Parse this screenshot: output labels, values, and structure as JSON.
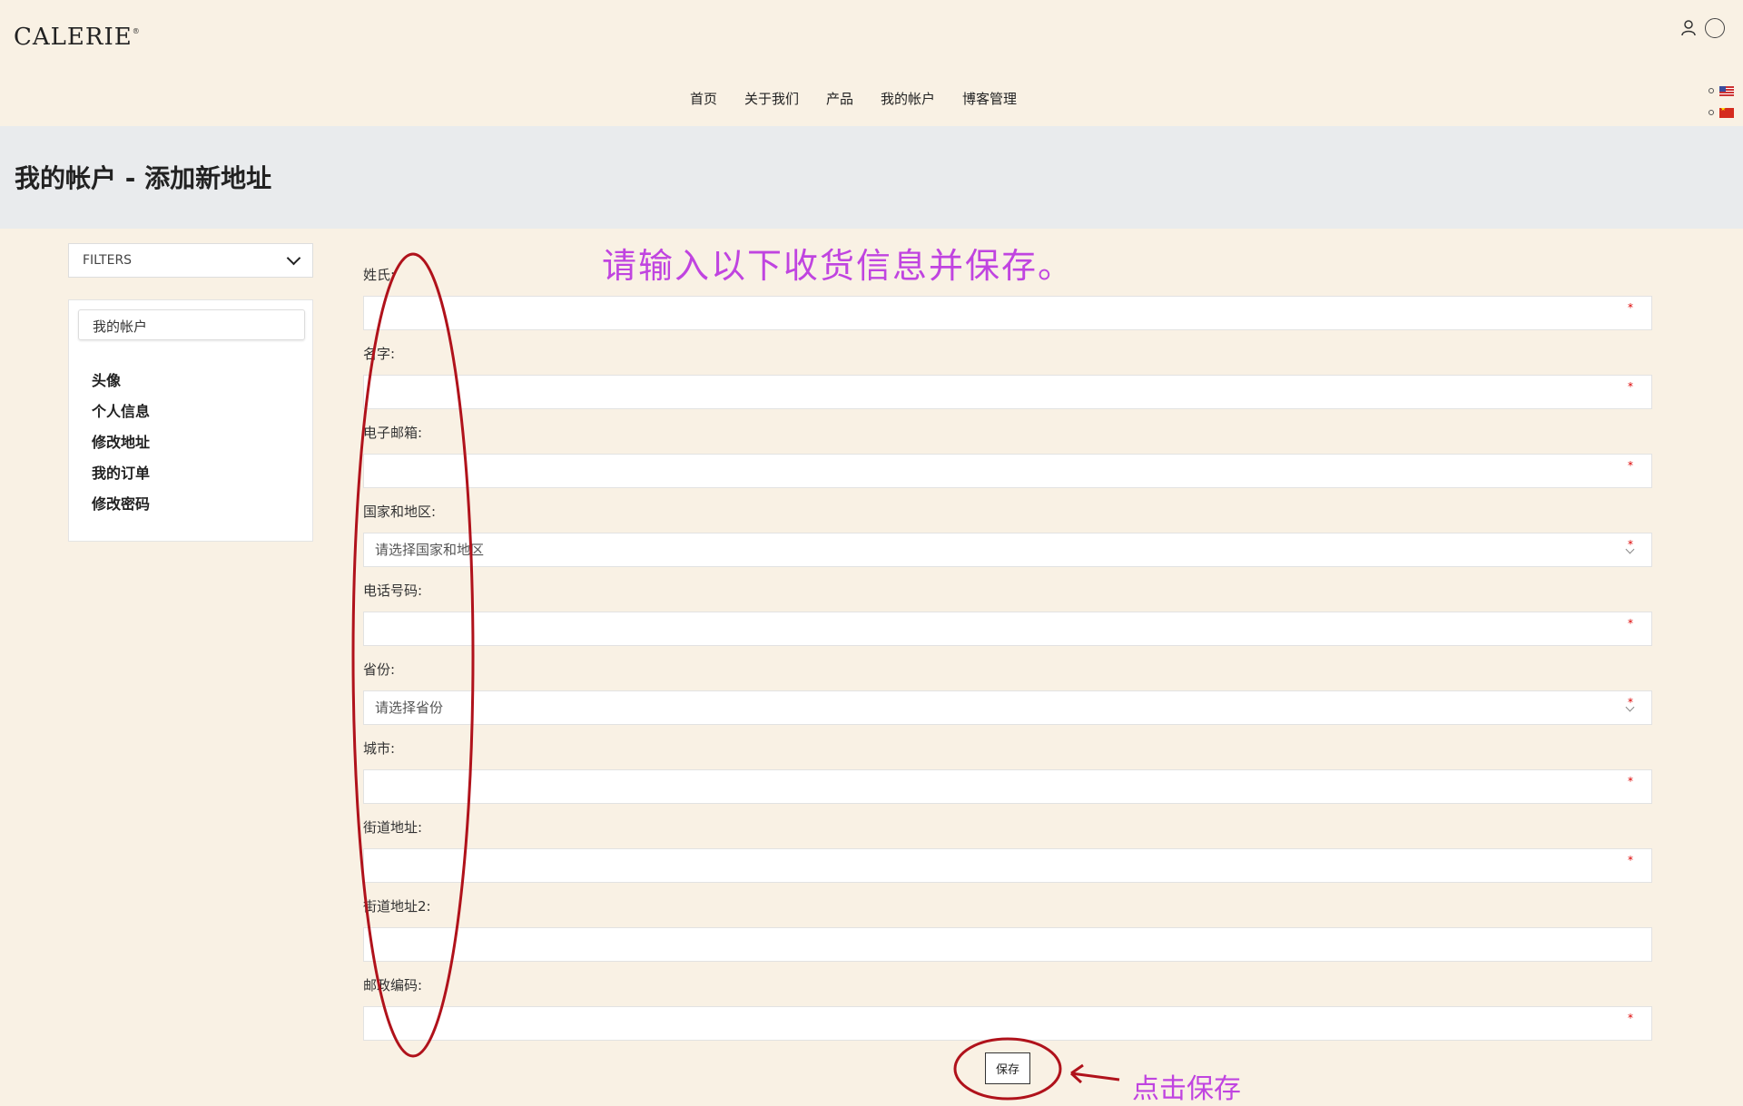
{
  "header": {
    "logo": "CALERIE",
    "logo_mark": "®",
    "nav": [
      "首页",
      "关于我们",
      "产品",
      "我的帐户",
      "博客管理"
    ]
  },
  "page": {
    "title": "我的帐户 - 添加新地址"
  },
  "sidebar": {
    "filters_label": "FILTERS",
    "panel_title": "我的帐户",
    "items": [
      "头像",
      "个人信息",
      "修改地址",
      "我的订单",
      "修改密码"
    ]
  },
  "form": {
    "fields": [
      {
        "label": "姓氏:",
        "value": "",
        "required_mark": "*"
      },
      {
        "label": "名字:",
        "value": "",
        "required_mark": "*"
      },
      {
        "label": "电子邮箱:",
        "value": "",
        "required_mark": "*"
      },
      {
        "label": "国家和地区:",
        "value": "请选择国家和地区",
        "required_mark": "*"
      },
      {
        "label": "电话号码:",
        "value": "",
        "required_mark": "*"
      },
      {
        "label": "省份:",
        "value": "请选择省份",
        "required_mark": "*"
      },
      {
        "label": "城市:",
        "value": "",
        "required_mark": "*"
      },
      {
        "label": "街道地址:",
        "value": "",
        "required_mark": "*"
      },
      {
        "label": "街道地址2:",
        "value": ""
      },
      {
        "label": "邮政编码:",
        "value": "",
        "required_mark": "*"
      }
    ],
    "save_label": "保存"
  },
  "annotations": {
    "instruction": "请输入以下收货信息并保存。",
    "save_hint": "点击保存",
    "color": "#c044e0",
    "circle_color": "#b0121b"
  },
  "icons": [
    "user-icon",
    "globe-icon",
    "us-flag-icon",
    "cn-flag-icon",
    "chevron-down-icon"
  ]
}
